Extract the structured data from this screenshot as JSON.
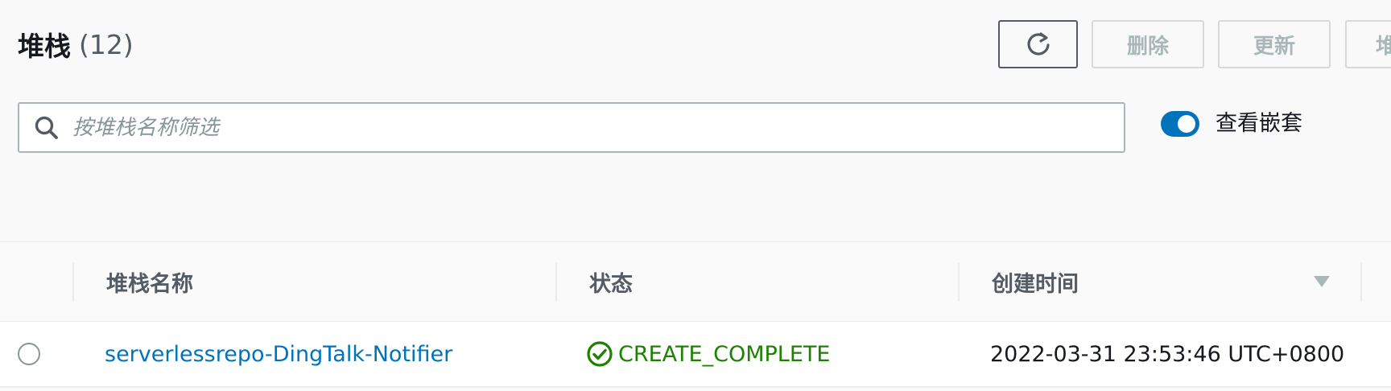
{
  "header": {
    "title": "堆栈",
    "count": "(12)",
    "buttons": {
      "refresh_icon": "refresh-icon",
      "delete_label": "删除",
      "update_label": "更新",
      "more_label": "堆"
    }
  },
  "search": {
    "placeholder": "按堆栈名称筛选",
    "value": "",
    "icon": "search-icon"
  },
  "toggle": {
    "label": "查看嵌套",
    "checked": true
  },
  "table": {
    "columns": [
      "堆栈名称",
      "状态",
      "创建时间"
    ],
    "sort_icon": "sort-descending-icon",
    "rows": [
      {
        "name": "serverlessrepo-DingTalk-Notifier",
        "status": "CREATE_COMPLETE",
        "status_icon": "check-circle-icon",
        "created": "2022-03-31 23:53:46 UTC+0800"
      }
    ]
  },
  "colors": {
    "link": "#0073bb",
    "success": "#1d8102",
    "toggle_on": "#0073bb",
    "disabled_text": "#aab7b8"
  }
}
